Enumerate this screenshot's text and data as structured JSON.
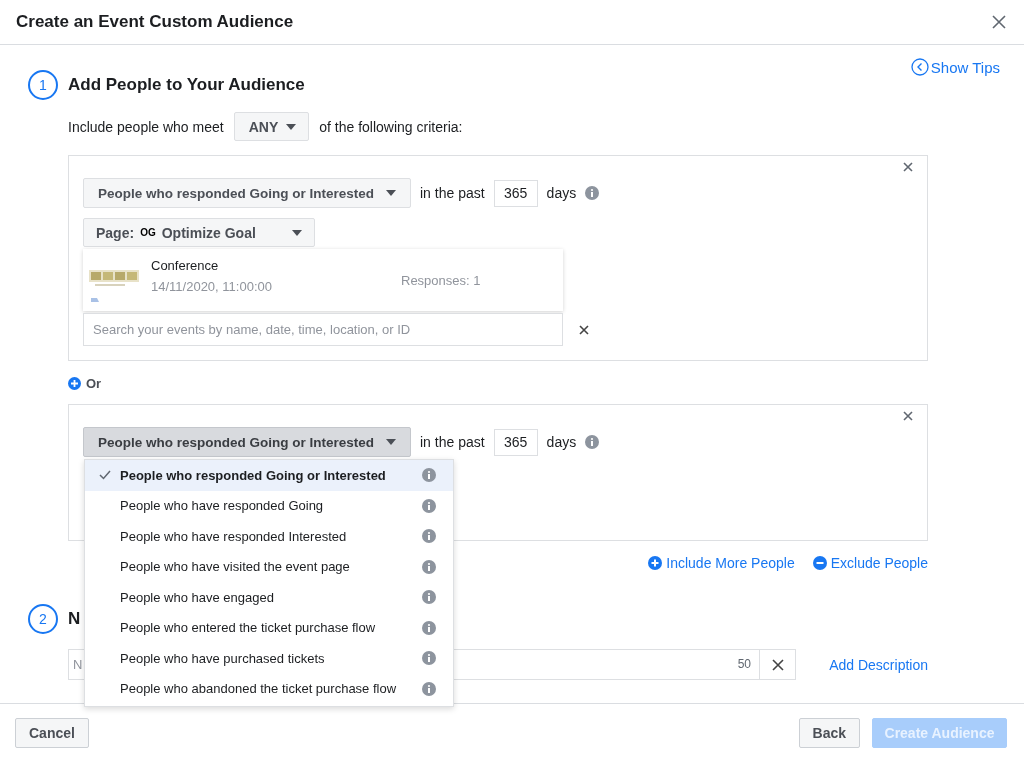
{
  "dialog": {
    "title": "Create an Event Custom Audience"
  },
  "show_tips": "Show Tips",
  "section_1": {
    "number": "1",
    "title": "Add People to Your Audience",
    "include_prefix": "Include people who meet",
    "match": "ANY",
    "include_suffix": "of the following criteria:"
  },
  "rules": [
    {
      "criterion": "People who responded Going or Interested",
      "expanded": false,
      "in_the_past": "in the past",
      "days_value": "365",
      "days_label": "days",
      "page_label": "Page:",
      "page_logo": "OG",
      "page_name": "Optimize Goal",
      "event": {
        "name": "Conference",
        "date": "14/11/2020, 11:00:00",
        "responses": "Responses: 1"
      },
      "search_placeholder": "Search your events by name, date, time, location, or ID"
    },
    {
      "criterion": "People who responded Going or Interested",
      "expanded": true,
      "in_the_past": "in the past",
      "days_value": "365",
      "days_label": "days"
    }
  ],
  "or_label": "Or",
  "criterion_menu": [
    {
      "label": "People who responded Going or Interested",
      "selected": true
    },
    {
      "label": "People who have responded Going",
      "selected": false
    },
    {
      "label": "People who have responded Interested",
      "selected": false
    },
    {
      "label": "People who have visited the event page",
      "selected": false
    },
    {
      "label": "People who have engaged",
      "selected": false
    },
    {
      "label": "People who entered the ticket purchase flow",
      "selected": false
    },
    {
      "label": "People who have purchased tickets",
      "selected": false
    },
    {
      "label": "People who abandoned the ticket purchase flow",
      "selected": false
    }
  ],
  "actions": [
    {
      "kind": "include",
      "label": "Include More People"
    },
    {
      "kind": "exclude",
      "label": "Exclude People"
    }
  ],
  "section_2": {
    "number": "2",
    "title": "N",
    "name_placeholder": "N",
    "char_count": "50",
    "add_description": "Add Description"
  },
  "footer": {
    "cancel": "Cancel",
    "back": "Back",
    "create": "Create Audience",
    "create_disabled": true
  }
}
